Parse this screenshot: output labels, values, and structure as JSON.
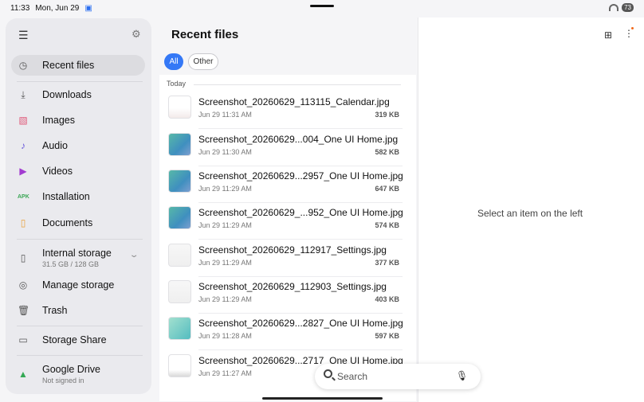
{
  "status": {
    "time": "11:33",
    "date": "Mon, Jun 29",
    "battery": "73"
  },
  "sidebar": {
    "items": [
      {
        "label": "Recent files",
        "icon": "clock-icon",
        "active": true
      },
      {
        "label": "Downloads",
        "icon": "download-icon"
      },
      {
        "label": "Images",
        "icon": "image-icon"
      },
      {
        "label": "Audio",
        "icon": "music-note-icon"
      },
      {
        "label": "Videos",
        "icon": "video-icon"
      },
      {
        "label": "Installation",
        "icon": "apk-icon",
        "icon_text": "APK"
      },
      {
        "label": "Documents",
        "icon": "document-icon"
      },
      {
        "label": "Internal storage",
        "sub": "31.5 GB / 128 GB",
        "icon": "phone-icon"
      },
      {
        "label": "Manage storage",
        "icon": "storage-icon"
      },
      {
        "label": "Trash",
        "icon": "trash-icon"
      },
      {
        "label": "Storage Share",
        "icon": "folder-icon"
      },
      {
        "label": "Google Drive",
        "sub": "Not signed in",
        "icon": "google-drive-icon"
      }
    ]
  },
  "header": {
    "title": "Recent files"
  },
  "filters": {
    "all": "All",
    "other": "Other"
  },
  "section": "Today",
  "files": [
    {
      "name": "Screenshot_20260629_113115_Calendar.jpg",
      "date": "Jun 29 11:31 AM",
      "size": "319 KB",
      "thumb": "calendar"
    },
    {
      "name": "Screenshot_20260629...004_One UI Home.jpg",
      "date": "Jun 29 11:30 AM",
      "size": "582 KB",
      "thumb": "home"
    },
    {
      "name": "Screenshot_20260629...2957_One UI Home.jpg",
      "date": "Jun 29 11:29 AM",
      "size": "647 KB",
      "thumb": "home"
    },
    {
      "name": "Screenshot_20260629_...952_One UI Home.jpg",
      "date": "Jun 29 11:29 AM",
      "size": "574 KB",
      "thumb": "home"
    },
    {
      "name": "Screenshot_20260629_112917_Settings.jpg",
      "date": "Jun 29 11:29 AM",
      "size": "377 KB",
      "thumb": "settings"
    },
    {
      "name": "Screenshot_20260629_112903_Settings.jpg",
      "date": "Jun 29 11:29 AM",
      "size": "403 KB",
      "thumb": "settings"
    },
    {
      "name": "Screenshot_20260629...2827_One UI Home.jpg",
      "date": "Jun 29 11:28 AM",
      "size": "597 KB",
      "thumb": "wallpaper"
    },
    {
      "name": "Screenshot_20260629...2717_One UI Home.jpg",
      "date": "Jun 29 11:27 AM",
      "size": "",
      "thumb": "dark"
    }
  ],
  "detail": {
    "empty_text": "Select an item on the left"
  },
  "search": {
    "label": "Search"
  },
  "colors": {
    "accent": "#3478f6",
    "notification_dot": "#f26a1b"
  }
}
